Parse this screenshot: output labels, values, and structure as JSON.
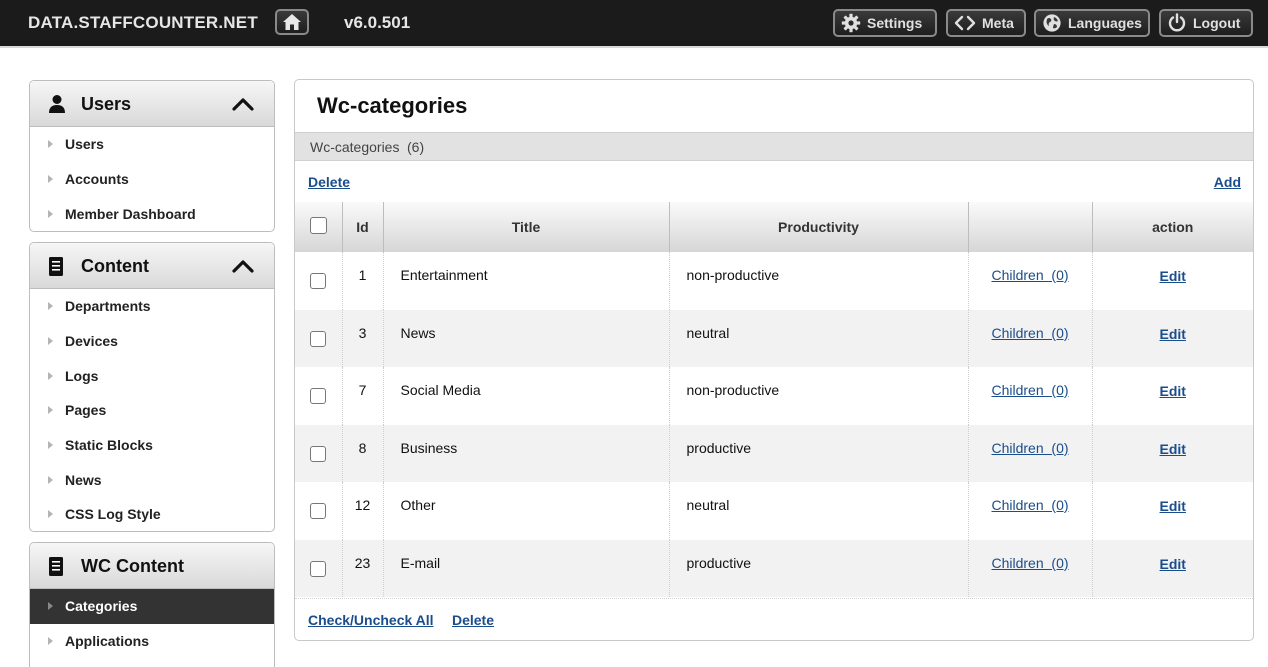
{
  "topbar": {
    "brand": "DATA.STAFFCOUNTER.NET",
    "version": "v6.0.501",
    "buttons": {
      "settings": "Settings",
      "meta": "Meta",
      "languages": "Languages",
      "logout": "Logout"
    }
  },
  "sidebar": {
    "users_panel": {
      "title": "Users",
      "items": [
        "Users",
        "Accounts",
        "Member Dashboard"
      ]
    },
    "content_panel": {
      "title": "Content",
      "items": [
        "Departments",
        "Devices",
        "Logs",
        "Pages",
        "Static Blocks",
        "News",
        "CSS Log Style"
      ]
    },
    "wc_panel": {
      "title": "WC Content",
      "items": [
        "Categories",
        "Applications"
      ],
      "active": "Categories"
    }
  },
  "main": {
    "title": "Wc-categories",
    "subbar_label": "Wc-categories",
    "subbar_count": "(6)",
    "delete_label": "Delete",
    "add_label": "Add",
    "columns": {
      "id": "Id",
      "title": "Title",
      "productivity": "Productivity",
      "children": "",
      "action": "action"
    },
    "rows": [
      {
        "id": "1",
        "title": "Entertainment",
        "productivity": "non-productive",
        "children": "Children  (0)",
        "action": "Edit"
      },
      {
        "id": "3",
        "title": "News",
        "productivity": "neutral",
        "children": "Children  (0)",
        "action": "Edit"
      },
      {
        "id": "7",
        "title": "Social Media",
        "productivity": "non-productive",
        "children": "Children  (0)",
        "action": "Edit"
      },
      {
        "id": "8",
        "title": "Business",
        "productivity": "productive",
        "children": "Children  (0)",
        "action": "Edit"
      },
      {
        "id": "12",
        "title": "Other",
        "productivity": "neutral",
        "children": "Children  (0)",
        "action": "Edit"
      },
      {
        "id": "23",
        "title": "E-mail",
        "productivity": "productive",
        "children": "Children  (0)",
        "action": "Edit"
      }
    ],
    "footer": {
      "check_all": "Check/Uncheck All",
      "delete": "Delete"
    }
  },
  "icons": {
    "home": "home-icon",
    "settings": "gear-icon",
    "meta": "code-icon",
    "languages": "globe-icon",
    "logout": "power-icon",
    "users_panel": "user-icon",
    "content_panel": "document-icon",
    "wc_panel": "document-icon",
    "collapse": "chevron-up-icon"
  },
  "colors": {
    "topbar_bg": "#1b1b1b",
    "link": "#1a4d8c",
    "active_nav": "#333333"
  }
}
